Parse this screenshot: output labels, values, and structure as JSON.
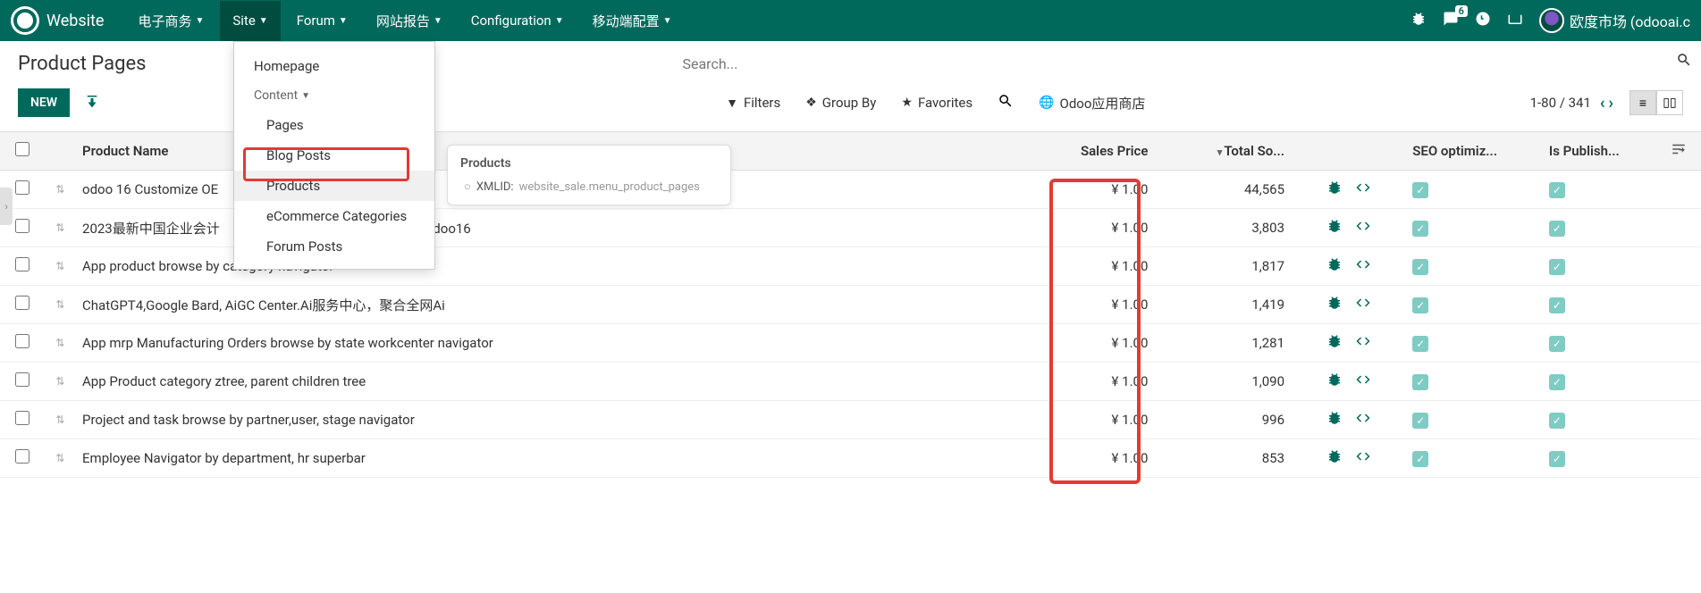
{
  "brand": "Website",
  "nav": {
    "items": [
      "电子商务",
      "Site",
      "Forum",
      "网站报告",
      "Configuration",
      "移动端配置"
    ],
    "active_index": 1
  },
  "topright": {
    "chat_count": "6",
    "user_label": "欧度市场 (odooai.c"
  },
  "dropdown": {
    "homepage": "Homepage",
    "content_header": "Content",
    "items": [
      "Pages",
      "Blog Posts",
      "Products",
      "eCommerce Categories",
      "Forum Posts"
    ],
    "highlighted_index": 2
  },
  "tooltip": {
    "title": "Products",
    "xmlid_key": "XMLID:",
    "xmlid_val": "website_sale.menu_product_pages"
  },
  "breadcrumb": "Product Pages",
  "buttons": {
    "new": "NEW"
  },
  "search": {
    "placeholder": "Search..."
  },
  "filters": {
    "filters": "Filters",
    "groupby": "Group By",
    "favorites": "Favorites",
    "appstore": "Odoo应用商店"
  },
  "pager": {
    "range": "1-80 / 341"
  },
  "columns": {
    "name": "Product Name",
    "price": "Sales Price",
    "sold": "Total So...",
    "seo": "SEO optimiz...",
    "pub": "Is Publish..."
  },
  "rows": [
    {
      "name": "odoo 16 Customize OE",
      "price": "¥ 1.00",
      "sold": "44,565"
    },
    {
      "name": "2023最新中国企业会计",
      "suffix": "odoo16",
      "price": "¥ 1.00",
      "sold": "3,803"
    },
    {
      "name": "App product browse by category navigator",
      "price": "¥ 1.00",
      "sold": "1,817"
    },
    {
      "name": "ChatGPT4,Google Bard, AiGC Center.Ai服务中心，聚合全网Ai",
      "price": "¥ 1.00",
      "sold": "1,419"
    },
    {
      "name": "App mrp Manufacturing Orders browse by state workcenter navigator",
      "price": "¥ 1.00",
      "sold": "1,281"
    },
    {
      "name": "App Product category ztree, parent children tree",
      "price": "¥ 1.00",
      "sold": "1,090"
    },
    {
      "name": "Project and task browse by partner,user, stage navigator",
      "price": "¥ 1.00",
      "sold": "996"
    },
    {
      "name": "Employee Navigator by department, hr superbar",
      "price": "¥ 1.00",
      "sold": "853"
    }
  ]
}
